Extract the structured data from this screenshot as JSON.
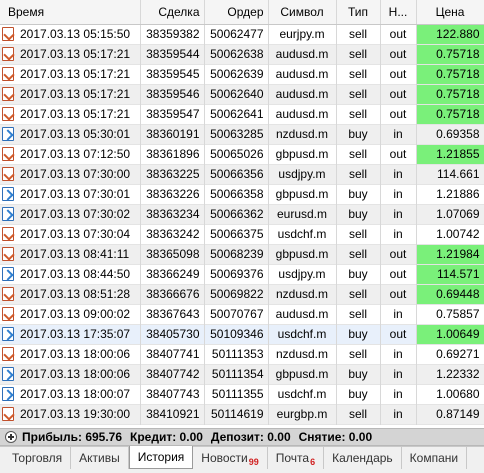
{
  "columns": {
    "time": "Время",
    "deal": "Сделка",
    "order": "Ордер",
    "symbol": "Символ",
    "type": "Тип",
    "direction": "Н...",
    "price": "Цена"
  },
  "rows": [
    {
      "icon": "sell",
      "time": "2017.03.13 05:15:50",
      "deal": "38359382",
      "order": "50062477",
      "symbol": "eurjpy.m",
      "type": "sell",
      "direction": "out",
      "price": "122.880",
      "highlight": true
    },
    {
      "icon": "sell",
      "time": "2017.03.13 05:17:21",
      "deal": "38359544",
      "order": "50062638",
      "symbol": "audusd.m",
      "type": "sell",
      "direction": "out",
      "price": "0.75718",
      "highlight": true
    },
    {
      "icon": "sell",
      "time": "2017.03.13 05:17:21",
      "deal": "38359545",
      "order": "50062639",
      "symbol": "audusd.m",
      "type": "sell",
      "direction": "out",
      "price": "0.75718",
      "highlight": true
    },
    {
      "icon": "sell",
      "time": "2017.03.13 05:17:21",
      "deal": "38359546",
      "order": "50062640",
      "symbol": "audusd.m",
      "type": "sell",
      "direction": "out",
      "price": "0.75718",
      "highlight": true
    },
    {
      "icon": "sell",
      "time": "2017.03.13 05:17:21",
      "deal": "38359547",
      "order": "50062641",
      "symbol": "audusd.m",
      "type": "sell",
      "direction": "out",
      "price": "0.75718",
      "highlight": true
    },
    {
      "icon": "buy",
      "time": "2017.03.13 05:30:01",
      "deal": "38360191",
      "order": "50063285",
      "symbol": "nzdusd.m",
      "type": "buy",
      "direction": "in",
      "price": "0.69358",
      "highlight": false
    },
    {
      "icon": "sell",
      "time": "2017.03.13 07:12:50",
      "deal": "38361896",
      "order": "50065026",
      "symbol": "gbpusd.m",
      "type": "sell",
      "direction": "out",
      "price": "1.21855",
      "highlight": true
    },
    {
      "icon": "sell",
      "time": "2017.03.13 07:30:00",
      "deal": "38363225",
      "order": "50066356",
      "symbol": "usdjpy.m",
      "type": "sell",
      "direction": "in",
      "price": "114.661",
      "highlight": false
    },
    {
      "icon": "buy",
      "time": "2017.03.13 07:30:01",
      "deal": "38363226",
      "order": "50066358",
      "symbol": "gbpusd.m",
      "type": "buy",
      "direction": "in",
      "price": "1.21886",
      "highlight": false
    },
    {
      "icon": "buy",
      "time": "2017.03.13 07:30:02",
      "deal": "38363234",
      "order": "50066362",
      "symbol": "eurusd.m",
      "type": "buy",
      "direction": "in",
      "price": "1.07069",
      "highlight": false
    },
    {
      "icon": "sell",
      "time": "2017.03.13 07:30:04",
      "deal": "38363242",
      "order": "50066375",
      "symbol": "usdchf.m",
      "type": "sell",
      "direction": "in",
      "price": "1.00742",
      "highlight": false
    },
    {
      "icon": "sell",
      "time": "2017.03.13 08:41:11",
      "deal": "38365098",
      "order": "50068239",
      "symbol": "gbpusd.m",
      "type": "sell",
      "direction": "out",
      "price": "1.21984",
      "highlight": true
    },
    {
      "icon": "buy",
      "time": "2017.03.13 08:44:50",
      "deal": "38366249",
      "order": "50069376",
      "symbol": "usdjpy.m",
      "type": "buy",
      "direction": "out",
      "price": "114.571",
      "highlight": true
    },
    {
      "icon": "sell",
      "time": "2017.03.13 08:51:28",
      "deal": "38366676",
      "order": "50069822",
      "symbol": "nzdusd.m",
      "type": "sell",
      "direction": "out",
      "price": "0.69448",
      "highlight": true
    },
    {
      "icon": "sell",
      "time": "2017.03.13 09:00:02",
      "deal": "38367643",
      "order": "50070767",
      "symbol": "audusd.m",
      "type": "sell",
      "direction": "in",
      "price": "0.75857",
      "highlight": false
    },
    {
      "icon": "buy",
      "time": "2017.03.13 17:35:07",
      "deal": "38405730",
      "order": "50109346",
      "symbol": "usdchf.m",
      "type": "buy",
      "direction": "out",
      "price": "1.00649",
      "highlight": true,
      "selected": true
    },
    {
      "icon": "sell",
      "time": "2017.03.13 18:00:06",
      "deal": "38407741",
      "order": "50111353",
      "symbol": "nzdusd.m",
      "type": "sell",
      "direction": "in",
      "price": "0.69271",
      "highlight": false
    },
    {
      "icon": "buy",
      "time": "2017.03.13 18:00:06",
      "deal": "38407742",
      "order": "50111354",
      "symbol": "gbpusd.m",
      "type": "buy",
      "direction": "in",
      "price": "1.22332",
      "highlight": false
    },
    {
      "icon": "buy",
      "time": "2017.03.13 18:00:07",
      "deal": "38407743",
      "order": "50111355",
      "symbol": "usdchf.m",
      "type": "buy",
      "direction": "in",
      "price": "1.00680",
      "highlight": false
    },
    {
      "icon": "sell",
      "time": "2017.03.13 19:30:00",
      "deal": "38410921",
      "order": "50114619",
      "symbol": "eurgbp.m",
      "type": "sell",
      "direction": "in",
      "price": "0.87149",
      "highlight": false
    }
  ],
  "status": {
    "profit": "Прибыль: 695.76",
    "credit": "Кредит: 0.00",
    "deposit": "Депозит: 0.00",
    "withdrawal": "Снятие: 0.00"
  },
  "tabs": [
    {
      "label": "Торговля",
      "badge": ""
    },
    {
      "label": "Активы",
      "badge": ""
    },
    {
      "label": "История",
      "badge": "",
      "active": true
    },
    {
      "label": "Новости",
      "badge": "99"
    },
    {
      "label": "Почта",
      "badge": "6"
    },
    {
      "label": "Календарь",
      "badge": ""
    },
    {
      "label": "Компани",
      "badge": ""
    }
  ],
  "colors": {
    "highlight_price": "#7af07a",
    "sell_icon": "#d05a2a",
    "buy_icon": "#2f7fd0"
  }
}
